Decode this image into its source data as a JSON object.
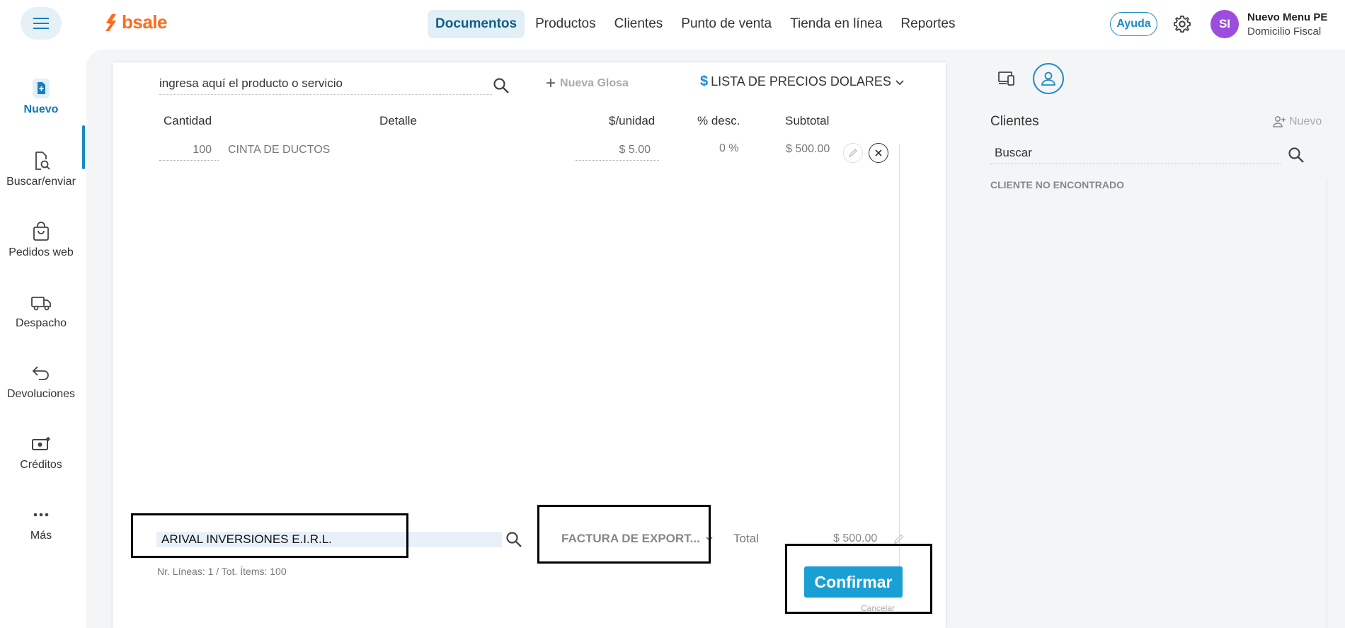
{
  "app": {
    "logo_text": "bsale",
    "brand_color": "#ff6b1a",
    "accent_color": "#1a8ac4"
  },
  "topnav": {
    "items": [
      {
        "label": "Documentos",
        "active": true
      },
      {
        "label": "Productos"
      },
      {
        "label": "Clientes"
      },
      {
        "label": "Punto de venta"
      },
      {
        "label": "Tienda en línea"
      },
      {
        "label": "Reportes"
      }
    ],
    "help_label": "Ayuda",
    "user": {
      "initials": "SI",
      "name": "Nuevo Menu PE",
      "subtitle": "Domicilio Fiscal"
    }
  },
  "sidebar": {
    "items": [
      {
        "label": "Nuevo",
        "icon": "file-plus-icon",
        "active": true
      },
      {
        "label": "Buscar/enviar",
        "icon": "file-search-icon"
      },
      {
        "label": "Pedidos web",
        "icon": "shopping-bag-icon"
      },
      {
        "label": "Despacho",
        "icon": "truck-icon"
      },
      {
        "label": "Devoluciones",
        "icon": "return-arrow-icon"
      },
      {
        "label": "Créditos",
        "icon": "money-plus-icon"
      },
      {
        "label": "Más",
        "icon": "more-dots-icon"
      }
    ]
  },
  "document": {
    "product_search_placeholder": "ingresa aquí el producto o servicio",
    "nueva_glosa_label": "Nueva Glosa",
    "price_list": {
      "symbol": "$",
      "label": "LISTA DE PRECIOS DOLARES"
    },
    "columns": [
      "Cantidad",
      "Detalle",
      "$/unidad",
      "% desc.",
      "Subtotal"
    ],
    "rows": [
      {
        "quantity": "100",
        "detail": "CINTA DE DUCTOS",
        "unit_price": "$ 5.00",
        "discount": "0 %",
        "subtotal": "$ 500.00"
      }
    ],
    "client_value": "ARIVAL INVERSIONES E.I.R.L.",
    "doc_type": "FACTURA DE EXPORT...",
    "total_label": "Total",
    "total_value": "$ 500.00",
    "lines_info": "Nr. Líneas: 1 / Tot. Ítems: 100",
    "confirm_label": "Confirmar",
    "cancel_label": "Cancelar"
  },
  "right_panel": {
    "title": "Clientes",
    "new_label": "Nuevo",
    "search_placeholder": "Buscar",
    "status": "CLIENTE NO ENCONTRADO"
  }
}
